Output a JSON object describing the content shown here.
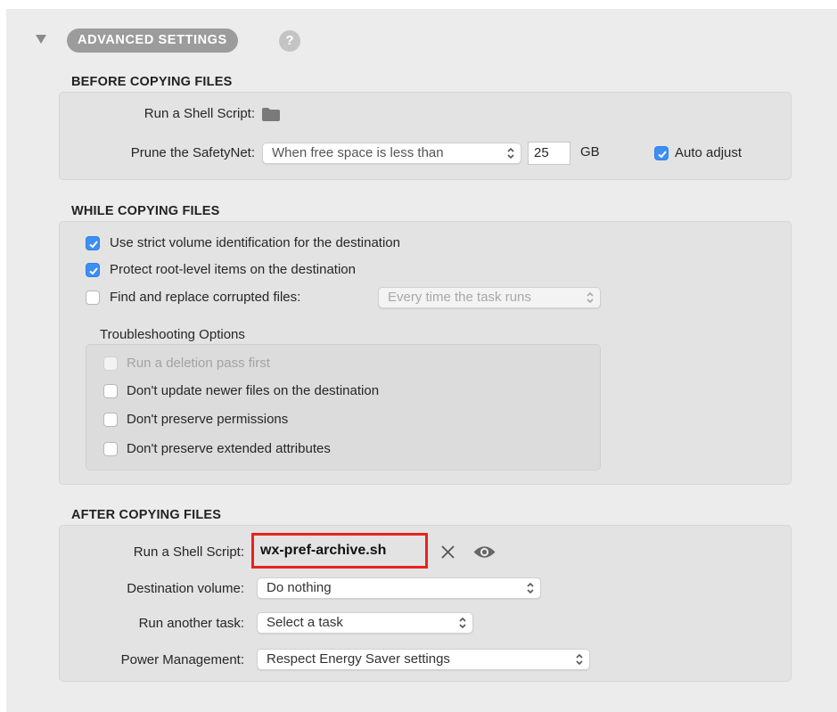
{
  "header": {
    "title": "ADVANCED SETTINGS",
    "help_glyph": "?"
  },
  "before": {
    "title": "BEFORE COPYING FILES",
    "shell_label": "Run a Shell Script:",
    "prune_label": "Prune the SafetyNet:",
    "prune_option": "When free space is less than",
    "prune_value": "25",
    "prune_unit": "GB",
    "auto_adjust_label": "Auto adjust",
    "auto_adjust_checked": true
  },
  "while": {
    "title": "WHILE COPYING FILES",
    "opt_strict": "Use strict volume identification for the destination",
    "opt_protect": "Protect root-level items on the destination",
    "opt_find_replace": "Find and replace corrupted files:",
    "find_replace_option": "Every time the task runs",
    "troubleshooting_title": "Troubleshooting Options",
    "opt_deletion_pass": "Run a deletion pass first",
    "opt_no_update_newer": "Don't update newer files on the destination",
    "opt_no_permissions": "Don't preserve permissions",
    "opt_no_xattrs": "Don't preserve extended attributes"
  },
  "after": {
    "title": "AFTER COPYING FILES",
    "shell_label": "Run a Shell Script:",
    "script_name": "wx-pref-archive.sh",
    "dest_volume_label": "Destination volume:",
    "dest_volume_value": "Do nothing",
    "another_task_label": "Run another task:",
    "another_task_value": "Select a task",
    "power_label": "Power Management:",
    "power_value": "Respect Energy Saver settings"
  },
  "colors": {
    "checkbox_on": "#3d8ff5",
    "highlight_border": "#e8231d",
    "panel_bg": "#ececec",
    "box_bg": "#e3e3e3"
  },
  "icons": [
    "disclosure-triangle-icon",
    "help-icon",
    "folder-icon",
    "checkmark-icon",
    "chevron-updown-icon",
    "close-icon",
    "eye-icon"
  ]
}
